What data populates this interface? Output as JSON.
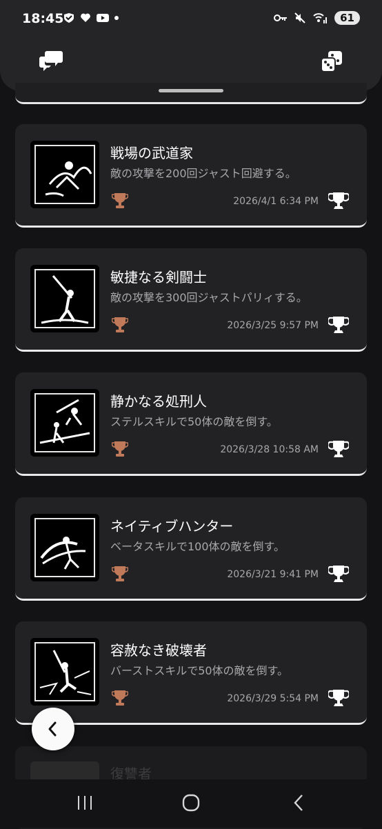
{
  "status_bar": {
    "time": "18:45",
    "battery": "61"
  },
  "header": {
    "chat_icon": "chat-bubbles-icon",
    "dice_icon": "dice-icon"
  },
  "colors": {
    "bronze": "#c07a5a",
    "background": "#131315",
    "card": "#222225"
  },
  "achievements": [
    {
      "title": "戦場の武道家",
      "description": "敵の攻撃を200回ジャスト回避する。",
      "date": "2026/4/1  6:34 PM",
      "tier": "bronze"
    },
    {
      "title": "敏捷なる剣闘士",
      "description": "敵の攻撃を300回ジャストパリィする。",
      "date": "2026/3/25  9:57 PM",
      "tier": "bronze"
    },
    {
      "title": "静かなる処刑人",
      "description": "ステルスキルで50体の敵を倒す。",
      "date": "2026/3/28  10:58 AM",
      "tier": "bronze"
    },
    {
      "title": "ネイティブハンター",
      "description": "ベータスキルで100体の敵を倒す。",
      "date": "2026/3/21  9:41 PM",
      "tier": "bronze"
    },
    {
      "title": "容赦なき破壊者",
      "description": "バーストスキルで50体の敵を倒す。",
      "date": "2026/3/29  5:54 PM",
      "tier": "bronze"
    },
    {
      "title": "復讐者",
      "description": "",
      "date": "",
      "tier": "bronze"
    }
  ]
}
